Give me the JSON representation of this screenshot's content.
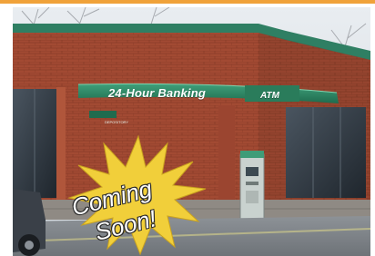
{
  "signage": {
    "canopy_main": "24-Hour Banking",
    "canopy_atm": "ATM",
    "depository": "DEPOSITORY"
  },
  "announcement": {
    "line1": "Coming",
    "line2": "Soon!"
  },
  "colors": {
    "accent_bar": "#f0a23a",
    "canopy_green": "#2f8a66",
    "brick": "#a04a32",
    "burst_yellow": "#f1cf3a"
  }
}
